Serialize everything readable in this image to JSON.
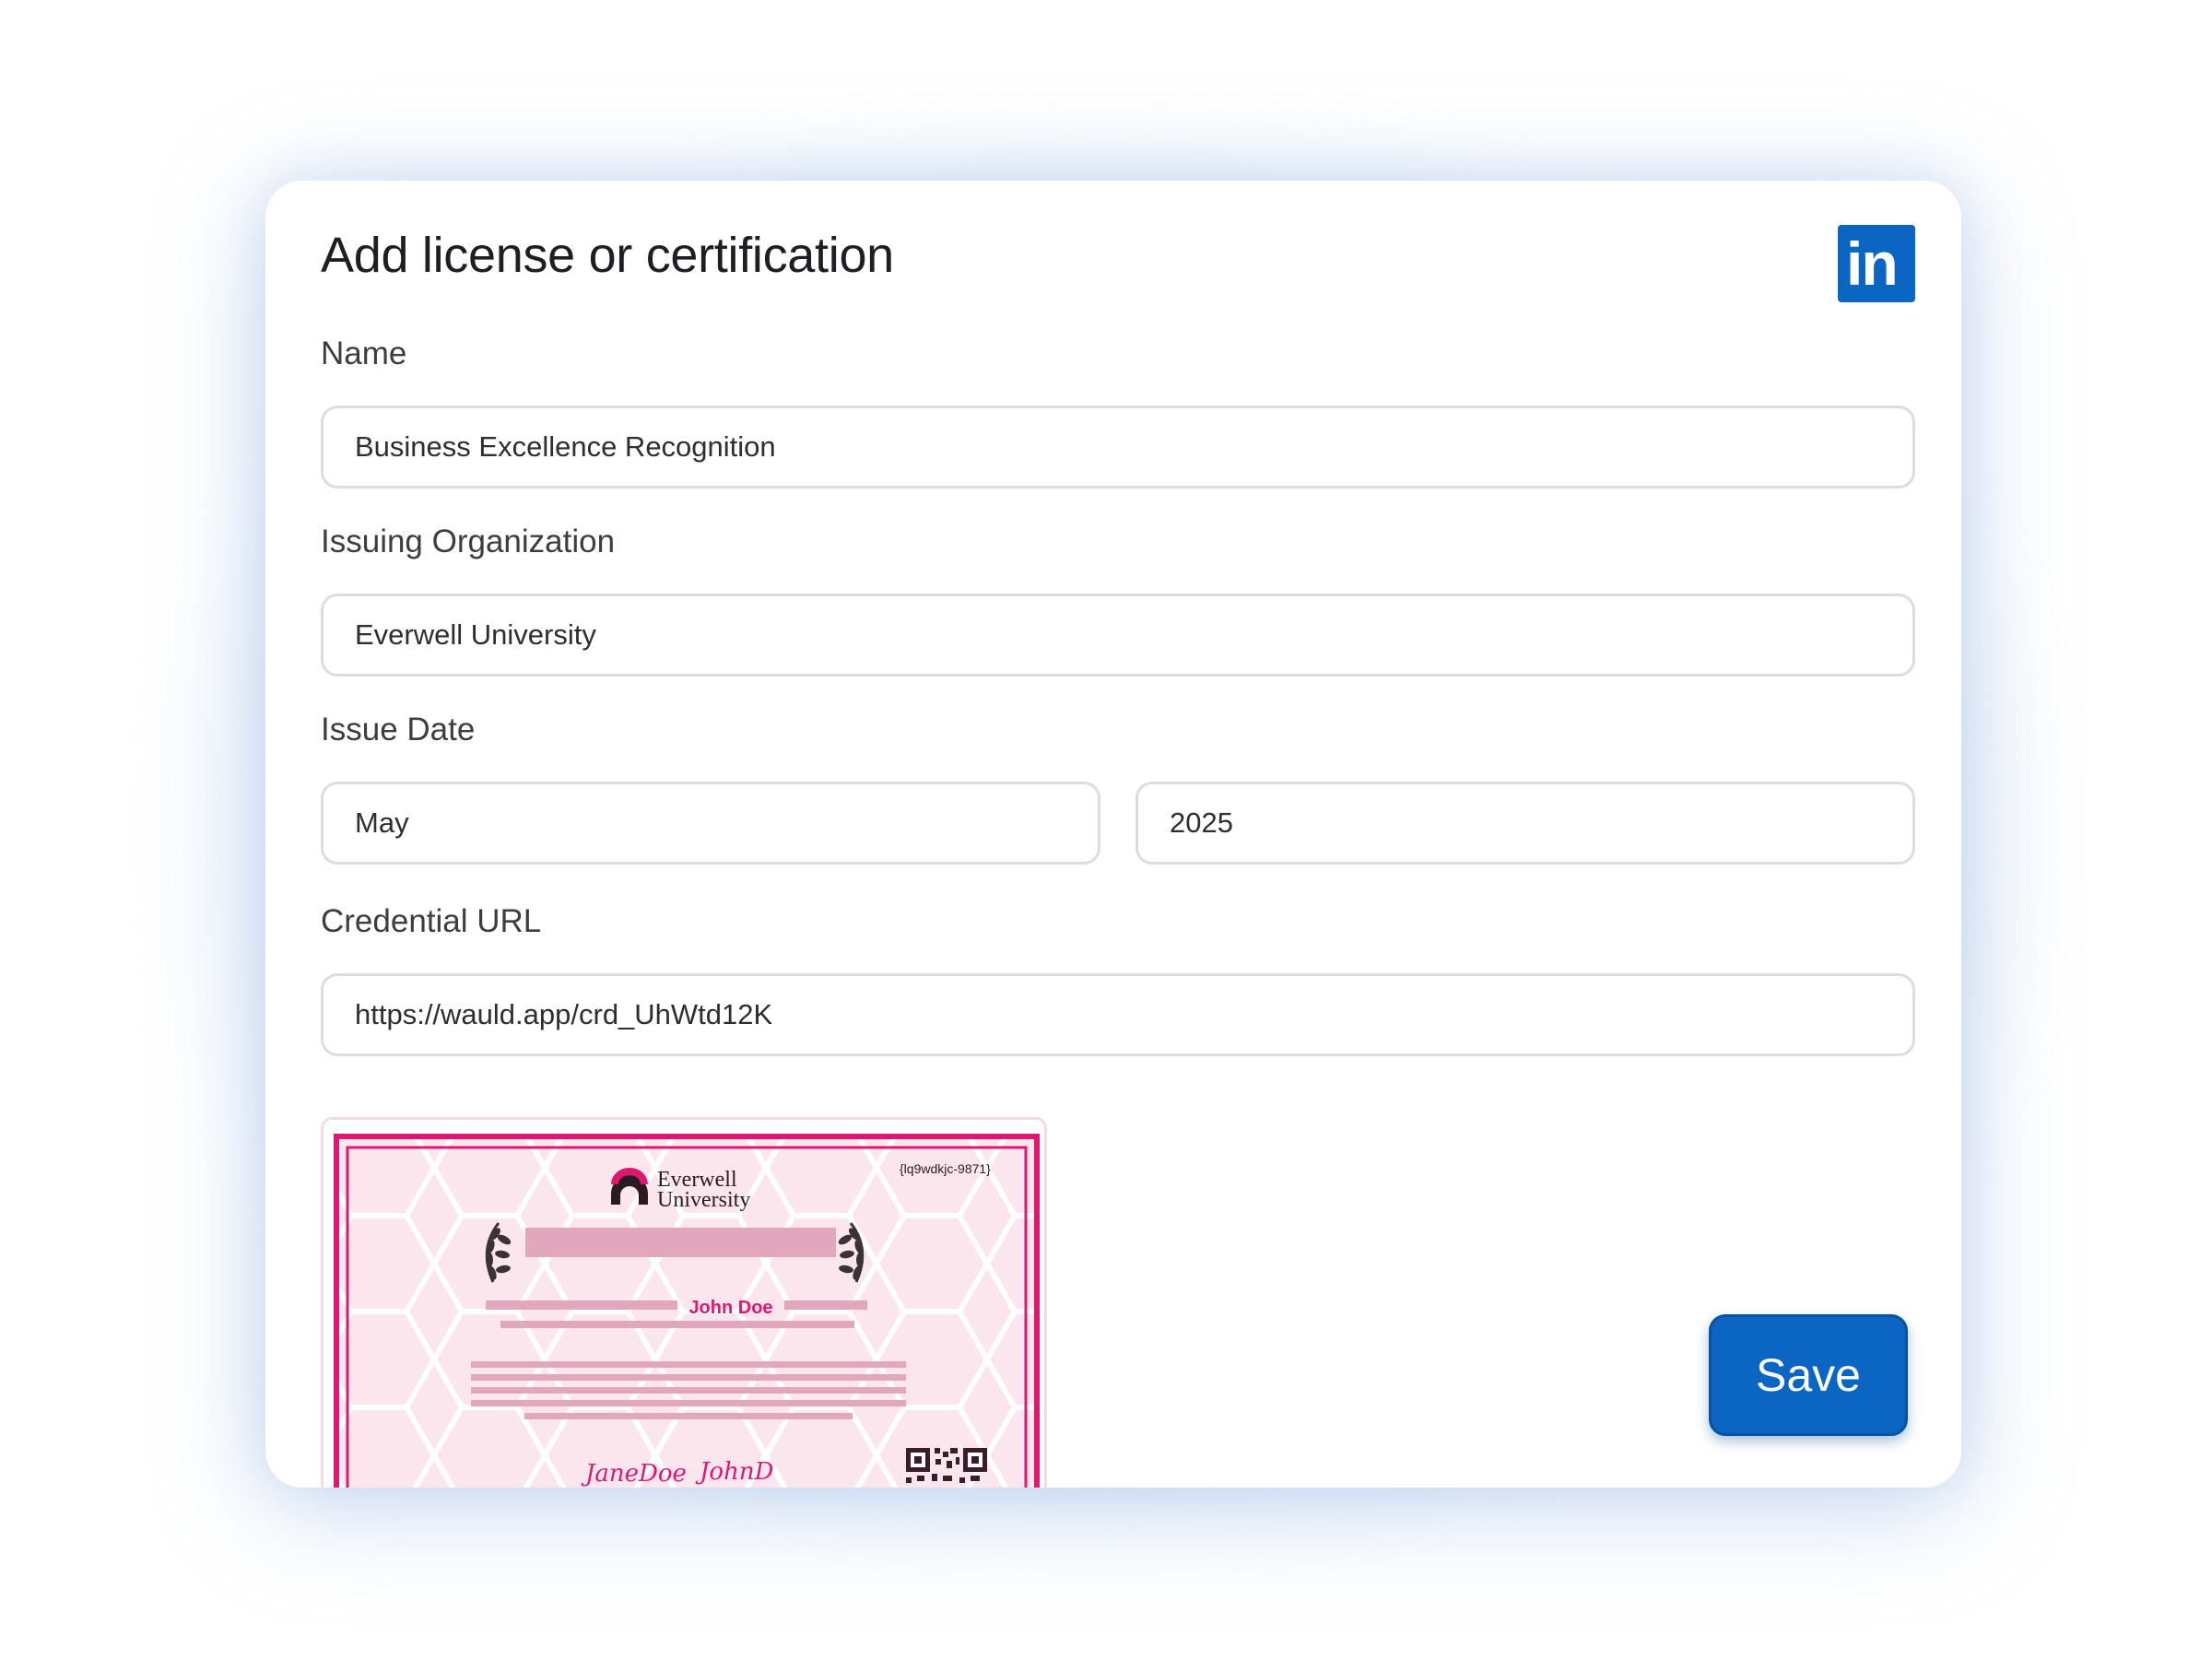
{
  "dialog": {
    "title": "Add license or certification",
    "brand_icon": "linkedin-icon",
    "brand_color": "#0a66c2"
  },
  "form": {
    "name_label": "Name",
    "name_value": "Business Excellence Recognition",
    "org_label": "Issuing Organization",
    "org_value": "Everwell University",
    "date_label": "Issue Date",
    "month_value": "May",
    "year_value": "2025",
    "url_label": "Credential URL",
    "url_value": "https://wauld.app/crd_UhWtd12K"
  },
  "certificate": {
    "org_line1": "Everwell",
    "org_line2": "University",
    "credential_id": "{lq9wdkjc-9871}",
    "recipient": "John Doe",
    "signature_1": "JaneDoe",
    "signature_2": "JohnD",
    "accent_color": "#e0176e"
  },
  "actions": {
    "save_label": "Save"
  }
}
